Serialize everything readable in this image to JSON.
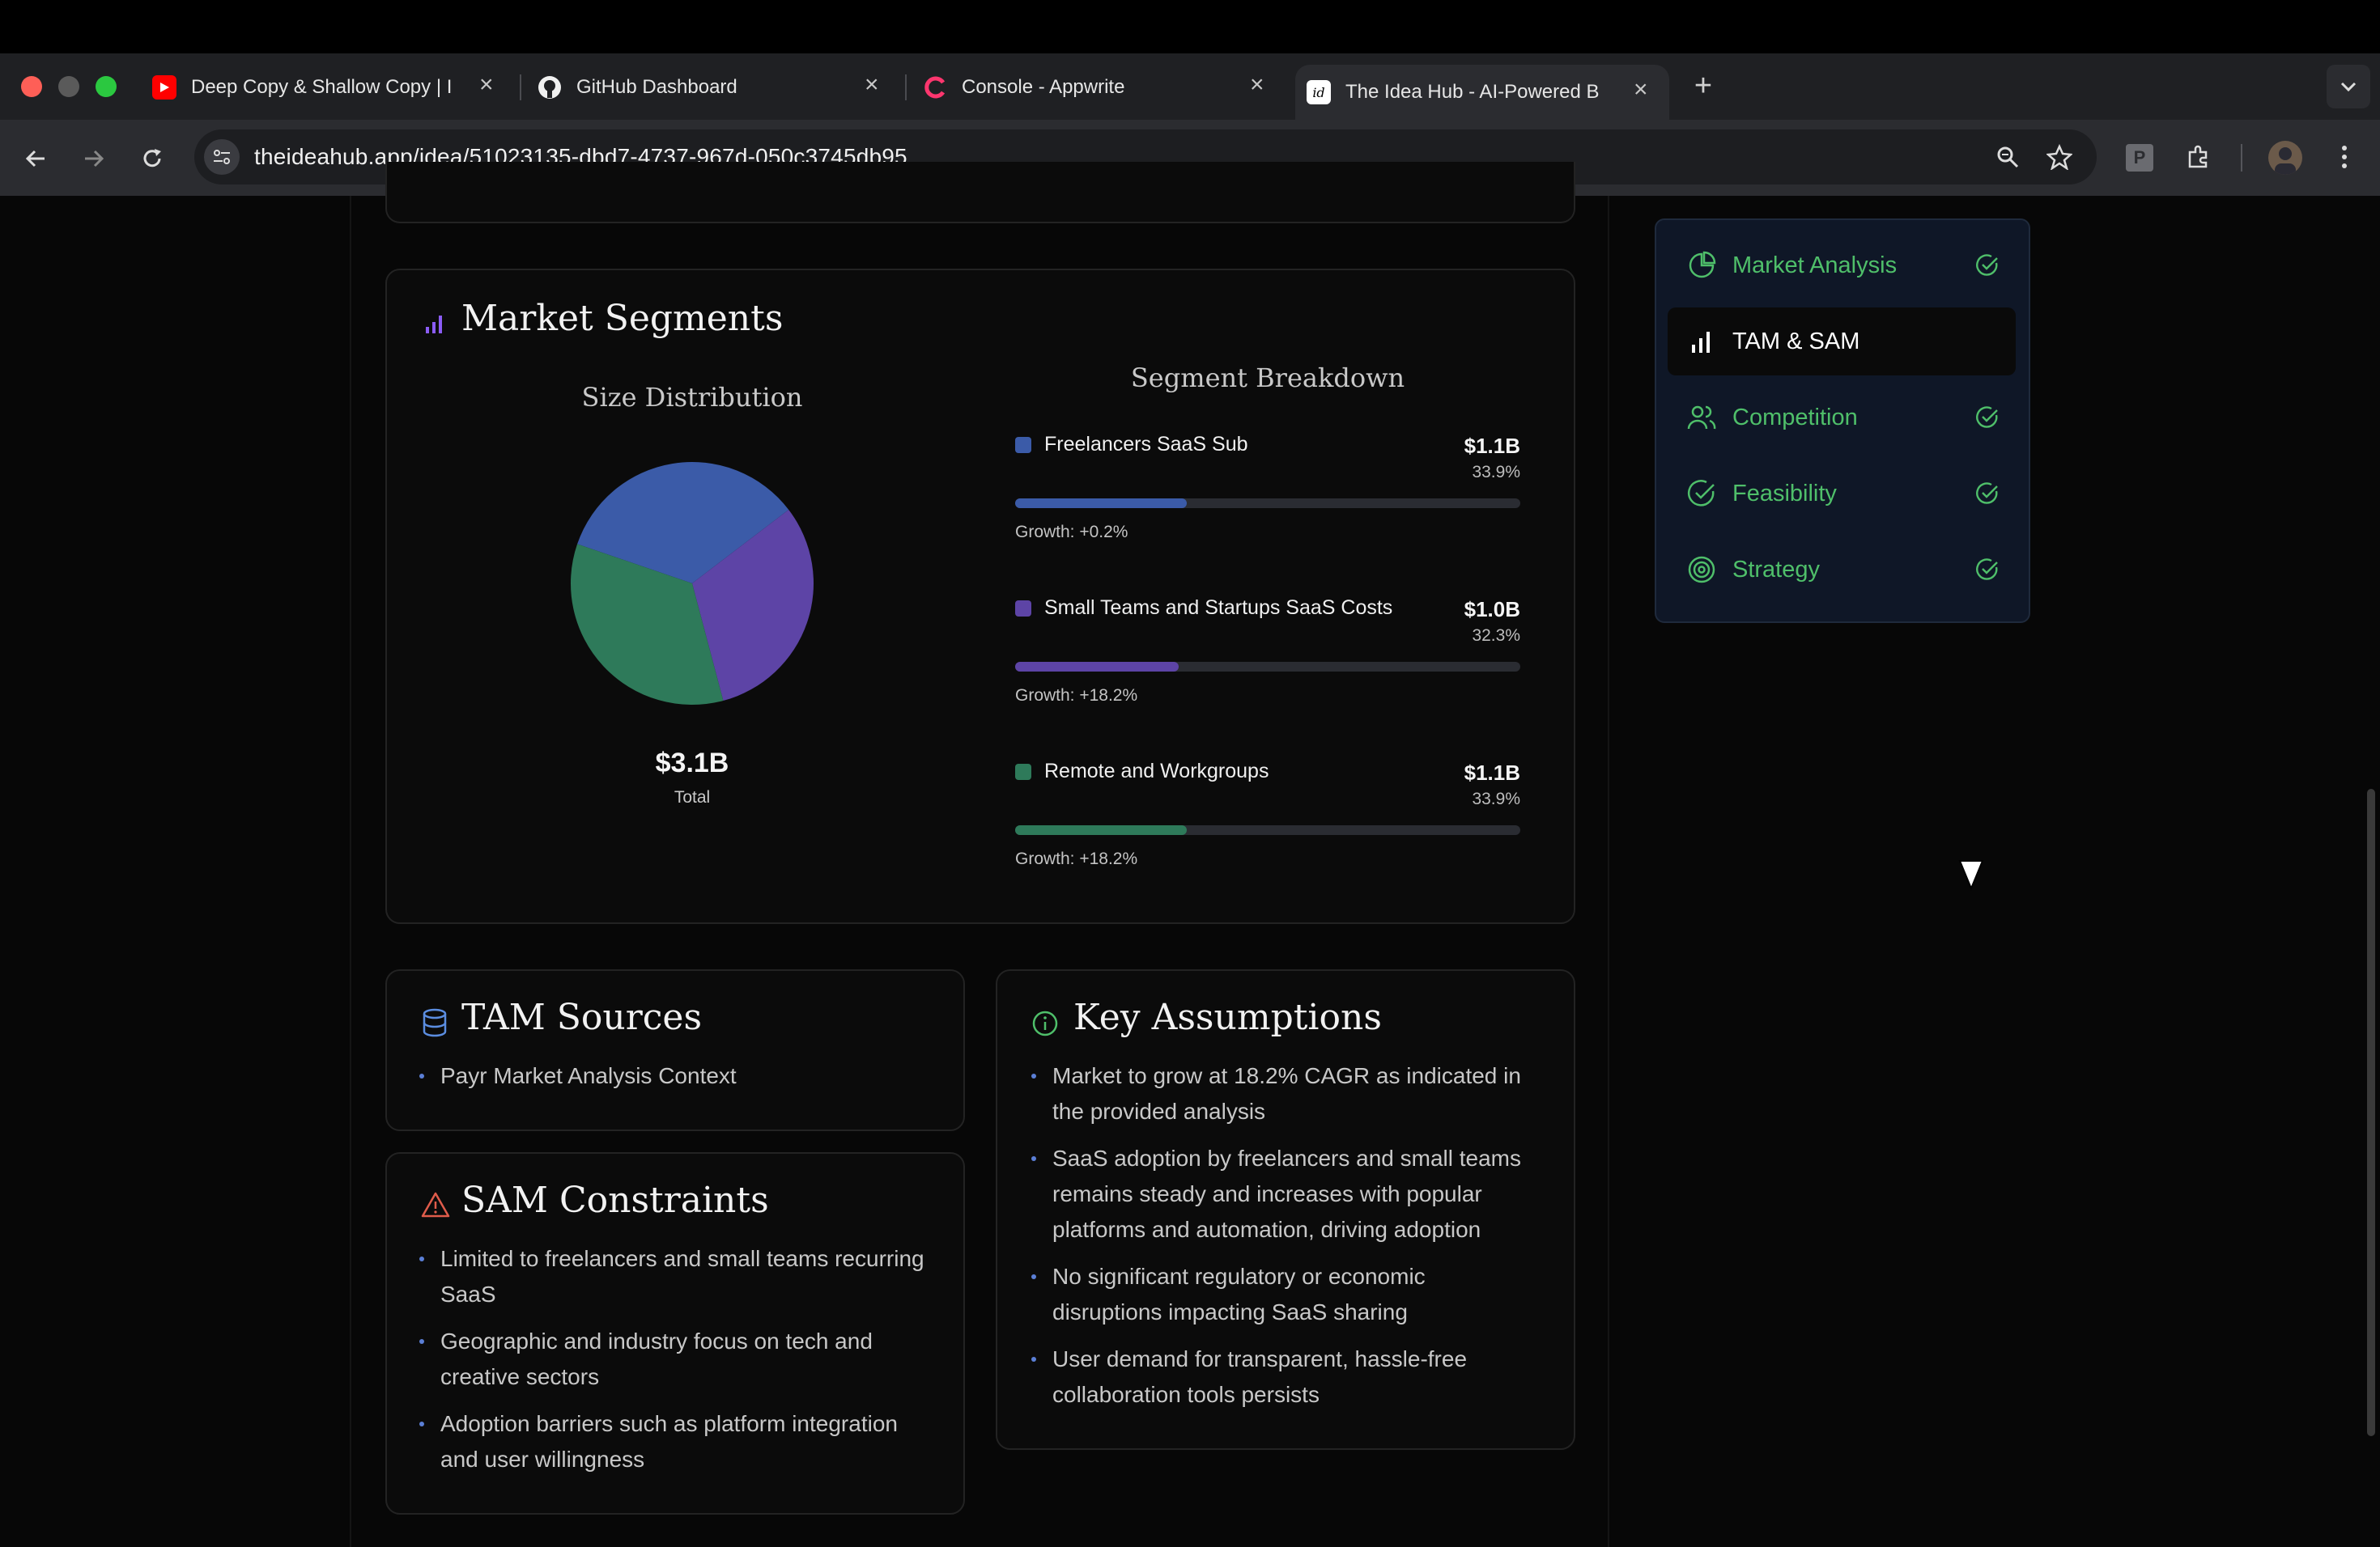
{
  "browser": {
    "tabs": [
      {
        "title": "Deep Copy & Shallow Copy | I"
      },
      {
        "title": "GitHub Dashboard"
      },
      {
        "title": "Console - Appwrite"
      },
      {
        "title": "The Idea Hub - AI-Powered B"
      }
    ],
    "url": "theideahub.app/idea/51023135-dbd7-4737-967d-050c3745db95",
    "profile_badge": "P"
  },
  "market_segments": {
    "title": "Market Segments",
    "size_distribution_label": "Size Distribution",
    "segment_breakdown_label": "Segment Breakdown",
    "total_value": "$3.1B",
    "total_label": "Total",
    "segments": [
      {
        "name": "Freelancers SaaS Sub",
        "value": "$1.1B",
        "percent": "33.9%",
        "growth": "Growth: +0.2%",
        "share": 0.339,
        "color": "#3b5ba8"
      },
      {
        "name": "Small Teams and Startups SaaS Costs",
        "value": "$1.0B",
        "percent": "32.3%",
        "growth": "Growth: +18.2%",
        "share": 0.323,
        "color": "#5d44a6"
      },
      {
        "name": "Remote and Workgroups",
        "value": "$1.1B",
        "percent": "33.9%",
        "growth": "Growth: +18.2%",
        "share": 0.339,
        "color": "#2e7a5a"
      }
    ]
  },
  "chart_data": {
    "type": "pie",
    "title": "Size Distribution",
    "categories": [
      "Freelancers SaaS Sub",
      "Small Teams and Startups SaaS Costs",
      "Remote and Workgroups"
    ],
    "values": [
      1.1,
      1.0,
      1.1
    ],
    "percent": [
      33.9,
      32.3,
      33.9
    ],
    "colors": [
      "#3b5ba8",
      "#5d44a6",
      "#2e7a5a"
    ]
  },
  "tam_sources": {
    "title": "TAM Sources",
    "items": [
      "Payr Market Analysis Context"
    ]
  },
  "sam_constraints": {
    "title": "SAM Constraints",
    "items": [
      "Limited to freelancers and small teams recurring SaaS",
      "Geographic and industry focus on tech and creative sectors",
      "Adoption barriers such as platform integration and user willingness"
    ]
  },
  "key_assumptions": {
    "title": "Key Assumptions",
    "items": [
      "Market to grow at 18.2% CAGR as indicated in the provided analysis",
      "SaaS adoption by freelancers and small teams remains steady and increases with popular platforms and automation, driving adoption",
      "No significant regulatory or economic disruptions impacting SaaS sharing",
      "User demand for transparent, hassle-free collaboration tools persists"
    ]
  },
  "nav": {
    "items": [
      {
        "label": "Market Analysis",
        "icon": "pie-chart-icon",
        "done": true
      },
      {
        "label": "TAM & SAM",
        "icon": "bar-chart-icon",
        "active": true
      },
      {
        "label": "Competition",
        "icon": "users-icon",
        "done": true
      },
      {
        "label": "Feasibility",
        "icon": "check-circle-icon",
        "done": true
      },
      {
        "label": "Strategy",
        "icon": "target-icon",
        "done": true
      }
    ]
  },
  "colors": {
    "accent_green": "#4fbf6a",
    "segment_blue": "#3b5ba8",
    "segment_purple": "#5d44a6",
    "segment_green": "#2e7a5a"
  }
}
